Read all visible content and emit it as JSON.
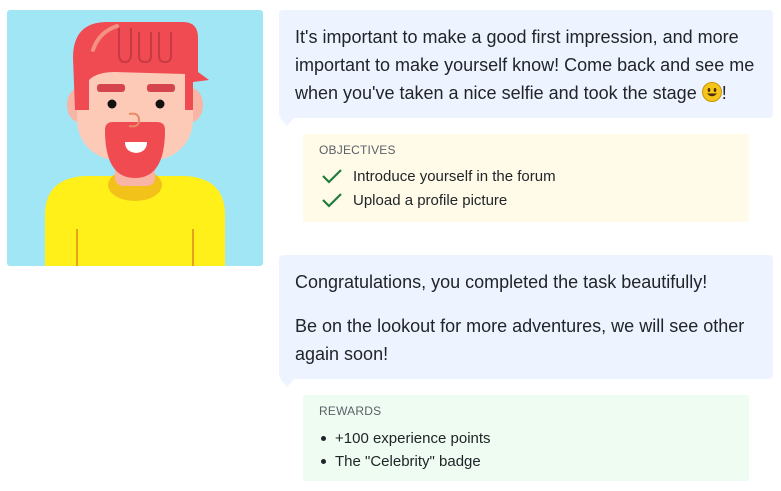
{
  "messages": [
    {
      "text": "It's important to make a good first impression, and more important to make yourself know! Come back and see me when you've taken a nice selfie and took the stage ",
      "emoji": "smiley-emoji",
      "suffix": "!"
    },
    {
      "paragraphs": [
        "Congratulations, you completed the task beautifully!",
        "Be on the lookout for more adventures, we will see other again soon!"
      ]
    }
  ],
  "objectives": {
    "title": "OBJECTIVES",
    "items": [
      "Introduce yourself in the forum",
      "Upload a profile picture"
    ],
    "icon": "check-icon",
    "check_color": "#1e7d3a"
  },
  "rewards": {
    "title": "REWARDS",
    "items": [
      "+100 experience points",
      "The \"Celebrity\" badge"
    ]
  },
  "colors": {
    "avatar_bg": "#a0e6f4",
    "bubble_bg": "#eef4ff",
    "objectives_bg": "#fffbe8",
    "rewards_bg": "#effcf2"
  }
}
